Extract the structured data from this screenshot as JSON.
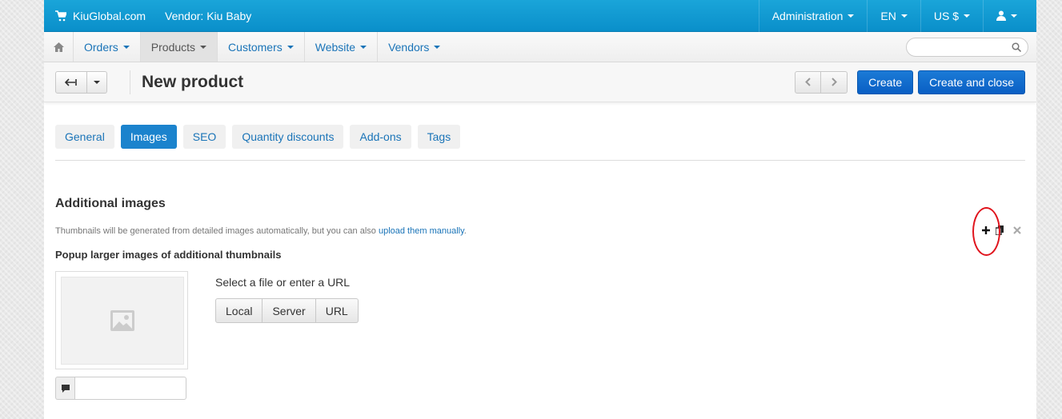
{
  "topbar": {
    "brand": "KiuGlobal.com",
    "vendor": "Vendor: Kiu Baby",
    "administration": "Administration",
    "language": "EN",
    "currency": "US $"
  },
  "nav": {
    "items": [
      "Orders",
      "Products",
      "Customers",
      "Website",
      "Vendors"
    ],
    "active": "Products",
    "search_placeholder": ""
  },
  "header": {
    "title": "New product",
    "create_label": "Create",
    "create_close_label": "Create and close"
  },
  "tabs": [
    "General",
    "Images",
    "SEO",
    "Quantity discounts",
    "Add-ons",
    "Tags"
  ],
  "active_tab": "Images",
  "images": {
    "section_title": "Additional images",
    "hint_text": "Thumbnails will be generated from detailed images automatically, but you can also",
    "hint_link": "upload them manually",
    "hint_end": ".",
    "popup_label": "Popup larger images of additional thumbnails",
    "file_label": "Select a file or enter a URL",
    "file_buttons": [
      "Local",
      "Server",
      "URL"
    ],
    "alt_value": ""
  },
  "colors": {
    "topbar": "#0a8fca",
    "primary_button": "#0a5fc4",
    "link": "#1a74b8",
    "highlight": "#e0141d"
  },
  "icons": [
    "cart-icon",
    "user-icon",
    "home-icon",
    "search-icon",
    "back-arrow-icon",
    "chevron-left-icon",
    "chevron-right-icon",
    "plus-icon",
    "clone-icon",
    "close-icon",
    "image-placeholder-icon",
    "comment-icon"
  ]
}
